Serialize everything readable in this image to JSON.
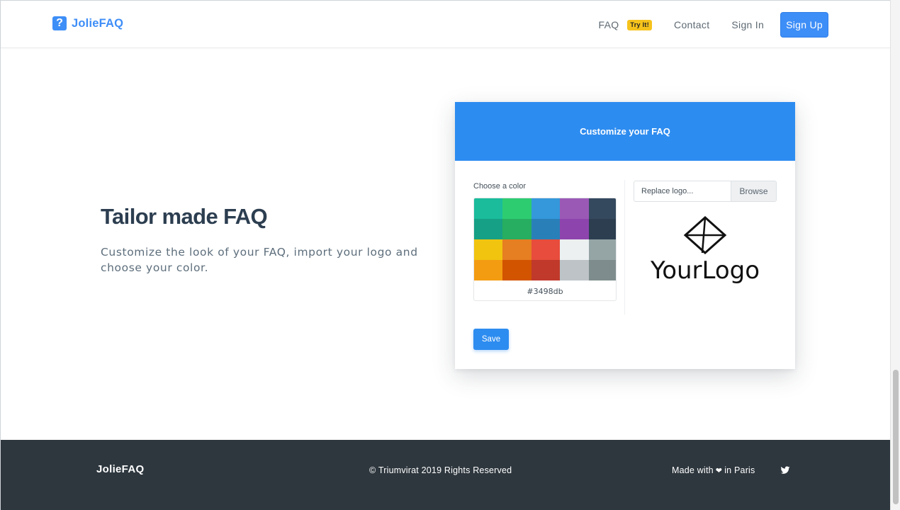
{
  "navbar": {
    "brand_icon_char": "?",
    "brand_name": "JolieFAQ",
    "items": {
      "faq": "FAQ",
      "faq_badge": "Try It!",
      "contact": "Contact",
      "signin": "Sign In",
      "signup": "Sign Up"
    }
  },
  "hero": {
    "title": "Tailor made FAQ",
    "description": "Customize the look of your FAQ, import your logo and choose your color."
  },
  "card": {
    "title": "Customize your FAQ",
    "color_label": "Choose a color",
    "swatches": [
      "#1abc9c",
      "#2ecc71",
      "#3498db",
      "#9b59b6",
      "#34495e",
      "#16a085",
      "#27ae60",
      "#2980b9",
      "#8e44ad",
      "#2c3e50",
      "#f1c40f",
      "#e67e22",
      "#e74c3c",
      "#ecf0f1",
      "#95a5a6",
      "#f39c12",
      "#d35400",
      "#c0392b",
      "#bdc3c7",
      "#7f8c8d"
    ],
    "selected_color": "#3498db",
    "file_placeholder": "Replace logo...",
    "browse_label": "Browse",
    "logo_text": "YourLogo",
    "save_label": "Save"
  },
  "footer": {
    "brand": "JolieFAQ",
    "copyright": "© Triumvirat 2019 Rights Reserved",
    "made_with_prefix": "Made with",
    "heart": "❤",
    "made_with_suffix": "in Paris"
  },
  "colors": {
    "primary": "#3e8ef7",
    "card_header": "#2d8cf0",
    "footer_bg": "#2e373e",
    "badge": "#f6c31c",
    "heading": "#2c3e50"
  },
  "icons": {
    "brand": "question-mark-icon",
    "logo": "diamond-logo-icon",
    "twitter": "twitter-icon"
  }
}
